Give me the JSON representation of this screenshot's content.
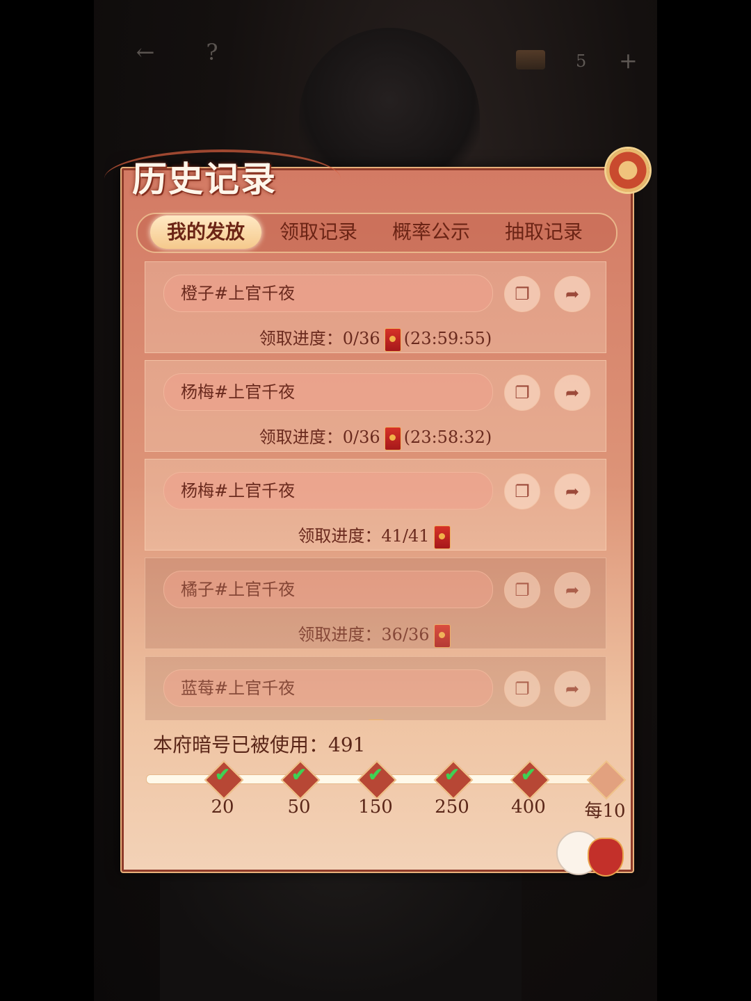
{
  "topbar": {
    "back_icon": "back-arrow-icon",
    "help_icon": "question-icon",
    "count": "5",
    "add": "+"
  },
  "panel": {
    "title": "历史记录"
  },
  "tabs": [
    {
      "label": "我的发放",
      "active": true
    },
    {
      "label": "领取记录",
      "active": false
    },
    {
      "label": "概率公示",
      "active": false
    },
    {
      "label": "抽取记录",
      "active": false
    }
  ],
  "records": [
    {
      "name": "橙子#上官千夜",
      "progress_label": "领取进度：",
      "progress": "0/36",
      "timer": "(23:59:55)"
    },
    {
      "name": "杨梅#上官千夜",
      "progress_label": "领取进度：",
      "progress": "0/36",
      "timer": "(23:58:32)"
    },
    {
      "name": "杨梅#上官千夜",
      "progress_label": "领取进度：",
      "progress": "41/41",
      "timer": ""
    },
    {
      "name": "橘子#上官千夜",
      "progress_label": "领取进度：",
      "progress": "36/36",
      "timer": ""
    },
    {
      "name": "蓝莓#上官千夜",
      "progress_label": "",
      "progress": "",
      "timer": ""
    }
  ],
  "usage": {
    "label": "本府暗号已被使用：491"
  },
  "milestones": [
    {
      "label": "20",
      "done": true
    },
    {
      "label": "50",
      "done": true
    },
    {
      "label": "150",
      "done": true
    },
    {
      "label": "250",
      "done": true
    },
    {
      "label": "400",
      "done": true
    },
    {
      "label": "每10",
      "done": false
    }
  ],
  "colors": {
    "accent": "#d37a64",
    "text": "#6a2a1e",
    "check": "#3fd154"
  }
}
